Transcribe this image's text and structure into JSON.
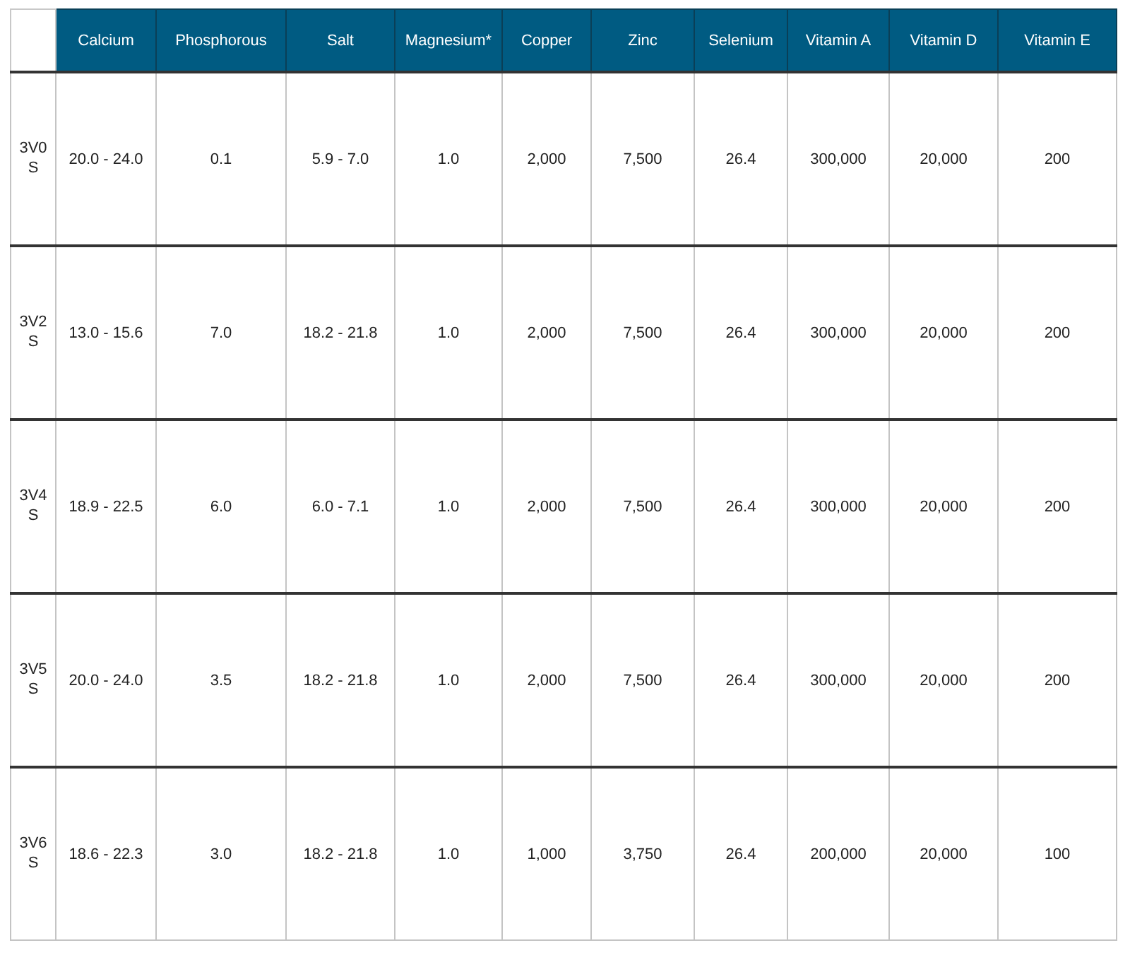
{
  "table": {
    "columns": [
      "",
      "Calcium",
      "Phosphorous",
      "Salt",
      "Magnesium*",
      "Copper",
      "Zinc",
      "Selenium",
      "Vitamin A",
      "Vitamin D",
      "Vitamin E"
    ],
    "rows": [
      [
        "3V0 S",
        "20.0 - 24.0",
        "0.1",
        "5.9 - 7.0",
        "1.0",
        "2,000",
        "7,500",
        "26.4",
        "300,000",
        "20,000",
        "200"
      ],
      [
        "3V2 S",
        "13.0 - 15.6",
        "7.0",
        "18.2 - 21.8",
        "1.0",
        "2,000",
        "7,500",
        "26.4",
        "300,000",
        "20,000",
        "200"
      ],
      [
        "3V4 S",
        "18.9 - 22.5",
        "6.0",
        "6.0 - 7.1",
        "1.0",
        "2,000",
        "7,500",
        "26.4",
        "300,000",
        "20,000",
        "200"
      ],
      [
        "3V5 S",
        "20.0 - 24.0",
        "3.5",
        "18.2 - 21.8",
        "1.0",
        "2,000",
        "7,500",
        "26.4",
        "300,000",
        "20,000",
        "200"
      ],
      [
        "3V6 S",
        "18.6 - 22.3",
        "3.0",
        "18.2 - 21.8",
        "1.0",
        "1,000",
        "3,750",
        "26.4",
        "200,000",
        "20,000",
        "100"
      ]
    ]
  }
}
